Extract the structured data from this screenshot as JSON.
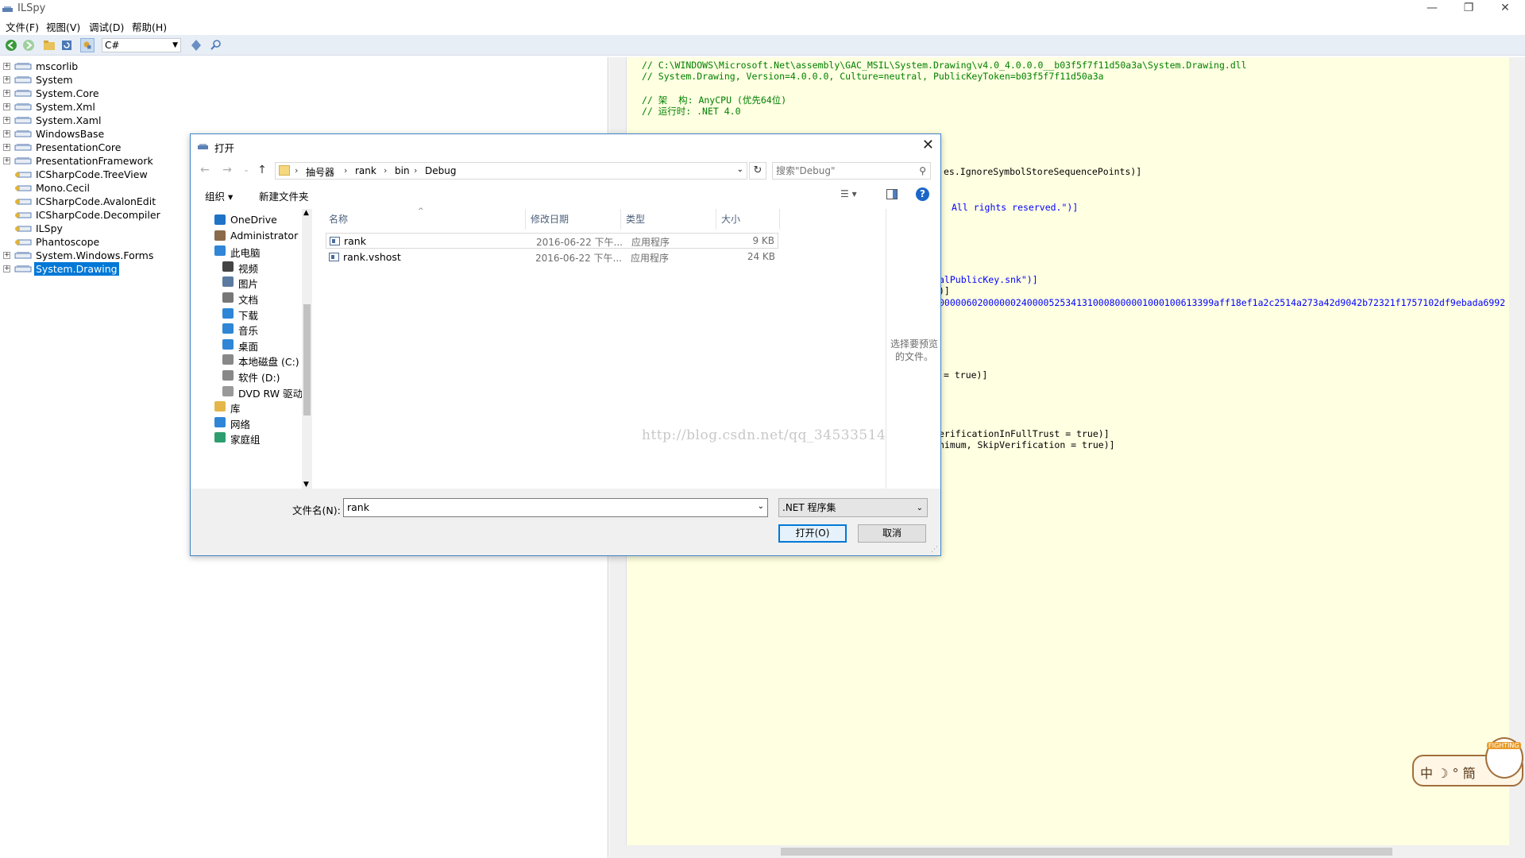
{
  "window": {
    "title": "ILSpy",
    "controls": {
      "minimize": "—",
      "maximize": "❐",
      "close": "✕"
    }
  },
  "menu": [
    "文件(F)",
    "视图(V)",
    "调试(D)",
    "帮助(H)"
  ],
  "toolbar": {
    "language": "C#"
  },
  "tree": [
    {
      "label": "mscorlib",
      "expandable": true
    },
    {
      "label": "System",
      "expandable": true
    },
    {
      "label": "System.Core",
      "expandable": true
    },
    {
      "label": "System.Xml",
      "expandable": true
    },
    {
      "label": "System.Xaml",
      "expandable": true
    },
    {
      "label": "WindowsBase",
      "expandable": true
    },
    {
      "label": "PresentationCore",
      "expandable": true
    },
    {
      "label": "PresentationFramework",
      "expandable": true
    },
    {
      "label": "ICSharpCode.TreeView",
      "expandable": false
    },
    {
      "label": "Mono.Cecil",
      "expandable": false
    },
    {
      "label": "ICSharpCode.AvalonEdit",
      "expandable": false
    },
    {
      "label": "ICSharpCode.Decompiler",
      "expandable": false
    },
    {
      "label": "ILSpy",
      "expandable": false
    },
    {
      "label": "Phantoscope",
      "expandable": false
    },
    {
      "label": "System.Windows.Forms",
      "expandable": true
    },
    {
      "label": "System.Drawing",
      "expandable": true,
      "selected": true
    }
  ],
  "code": {
    "comments": [
      "// C:\\WINDOWS\\Microsoft.Net\\assembly\\GAC_MSIL\\System.Drawing\\v4.0_4.0.0.0__b03f5f7f11d50a3a\\System.Drawing.dll",
      "// System.Drawing, Version=4.0.0.0, Culture=neutral, PublicKeyToken=b03f5f7f11d50a3a",
      "",
      "// 架  构: AnyCPU (优先64位)",
      "// 运行时: .NET 4.0"
    ],
    "fragments": [
      "es.IgnoreSymbolStoreSequencePoints)]",
      "All rights reserved.\")]",
      "alPublicKey.snk\")]",
      ")]",
      "00000602000000240000525341310008000001000100613399aff18ef1a2c2514a273a42d9042b72321f1757102df9ebada6992",
      "= true)]",
      "erificationInFullTrust = true)]",
      "nimum, SkipVerification = true)]"
    ]
  },
  "dialog": {
    "title": "打开",
    "breadcrumb": [
      "抽号器",
      "rank",
      "bin",
      "Debug"
    ],
    "search_placeholder": "搜索\"Debug\"",
    "commands": {
      "organize": "组织 ▾",
      "new_folder": "新建文件夹"
    },
    "nav": [
      {
        "label": "OneDrive",
        "icon": "cloud-icon"
      },
      {
        "label": "Administrator",
        "icon": "user-icon"
      },
      {
        "label": "此电脑",
        "icon": "computer-icon"
      },
      {
        "label": "视频",
        "icon": "video-icon"
      },
      {
        "label": "图片",
        "icon": "picture-icon"
      },
      {
        "label": "文档",
        "icon": "document-icon"
      },
      {
        "label": "下载",
        "icon": "download-icon"
      },
      {
        "label": "音乐",
        "icon": "music-icon"
      },
      {
        "label": "桌面",
        "icon": "desktop-icon"
      },
      {
        "label": "本地磁盘 (C:)",
        "icon": "drive-icon"
      },
      {
        "label": "软件 (D:)",
        "icon": "drive-icon"
      },
      {
        "label": "DVD RW 驱动",
        "icon": "dvd-icon"
      },
      {
        "label": "库",
        "icon": "library-icon"
      },
      {
        "label": "网络",
        "icon": "network-icon"
      },
      {
        "label": "家庭组",
        "icon": "homegroup-icon"
      }
    ],
    "columns": [
      "名称",
      "修改日期",
      "类型",
      "大小"
    ],
    "files": [
      {
        "name": "rank",
        "date": "2016-06-22 下午...",
        "type": "应用程序",
        "size": "9 KB"
      },
      {
        "name": "rank.vshost",
        "date": "2016-06-22 下午...",
        "type": "应用程序",
        "size": "24 KB"
      }
    ],
    "preview_text": "选择要预览的文件。",
    "filename_label": "文件名(N):",
    "filename_value": "rank",
    "filter": ".NET 程序集",
    "open_label": "打开(O)",
    "cancel_label": "取消"
  },
  "watermark": "http://blog.csdn.net/qq_34533514",
  "ime": {
    "text": "中 ☽ ° 簡",
    "tag": "FIGHTING"
  },
  "colors": {
    "selection": "#0078d7",
    "code_bg": "#ffffe1",
    "comment": "#008000",
    "keyword": "#0000ff"
  }
}
